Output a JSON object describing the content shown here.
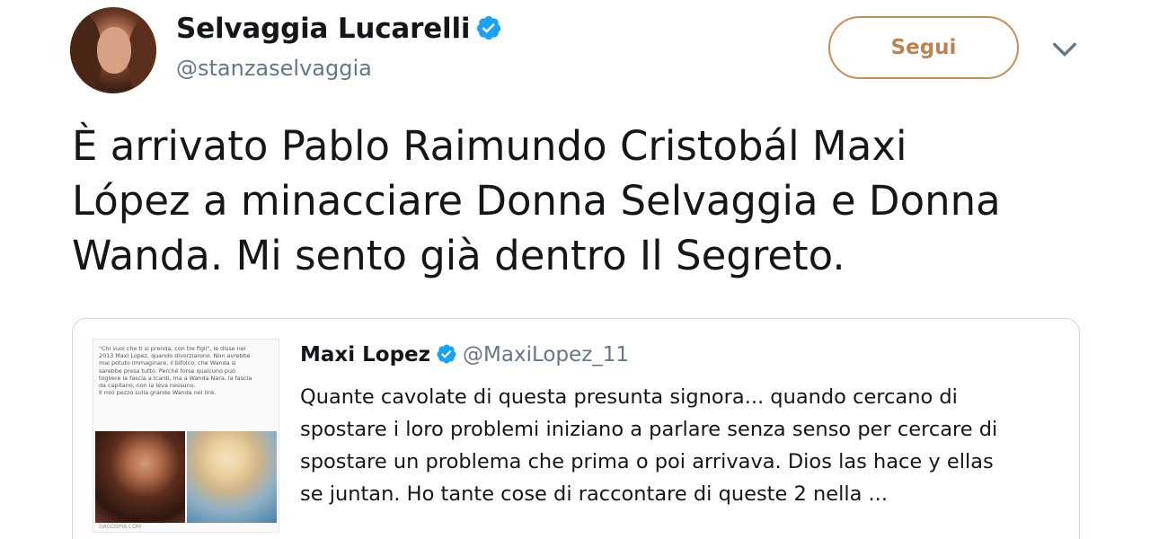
{
  "author": {
    "name": "Selvaggia Lucarelli",
    "handle": "@stanzaselvaggia",
    "avatar_icon": "profile-photo"
  },
  "actions": {
    "follow_label": "Segui",
    "menu_icon": "chevron-down-icon"
  },
  "tweet": {
    "lines": [
      "È arrivato Pablo Raimundo Cristobál Maxi",
      "López a minacciare Donna Selvaggia e Donna",
      "Wanda. Mi sento già dentro Il Segreto."
    ]
  },
  "quoted": {
    "name": "Maxi Lopez",
    "handle": "@MaxiLopez_11",
    "lines": [
      "Quante cavolate di questa presunta signora... quando cercano di",
      "spostare i loro problemi iniziano a parlare senza senso per cercare di",
      "spostare un problema che prima o poi arrivava. Dios las hace y ellas",
      "se juntan. Ho tante cose di raccontare di queste 2 nella ..."
    ],
    "thumbnail": {
      "caption_lines": [
        "\"Chi vuoi che ti si prenda, con tre figli\", le disse nel",
        "2013 Maxi Lopez, quando divorziarono. Non avrebbe",
        "mai potuto immaginare, il bifolco, che Wanda si",
        "sarebbe presa tutto. Perché forse qualcuno può",
        "togliere la fascia a Icardi, ma a Wanda Nara, la fascia",
        "da capitano, non la leva nessuno.",
        "Il mio pezzo sulla grande Wanda nel link."
      ],
      "site": "DAGOSPIA.COM"
    }
  },
  "colors": {
    "verified": "#1da1f2",
    "follow_accent": "#b88454",
    "secondary_text": "#657786",
    "border": "#ccd6dd"
  }
}
